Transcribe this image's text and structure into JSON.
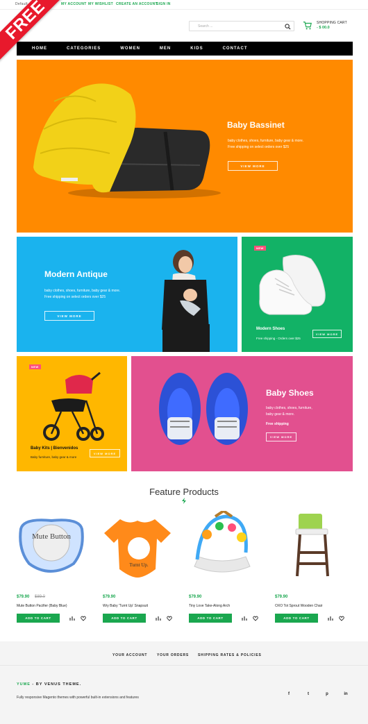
{
  "topbar": {
    "default_label": "Default",
    "links": [
      "My Account",
      "My Wishlist",
      "Create an Account",
      "Sign In"
    ]
  },
  "ribbon": "FREE",
  "search": {
    "placeholder": "Search ..."
  },
  "cart": {
    "label": "Shopping Cart",
    "amount": "- $ 00.0"
  },
  "nav": [
    "Home",
    "Categories",
    "Women",
    "Men",
    "Kids",
    "Contact"
  ],
  "banners": {
    "bassinet": {
      "title": "Baby Bassinet",
      "line1": "baby clothes, shoes, furniture, baby gear & more.",
      "line2": "Free shipping on select orders over $25",
      "button": "View More",
      "bg": "#ff8a00"
    },
    "antique": {
      "title": "Modern Antique",
      "line1": "baby clothes, shoes, furniture, baby gear & more.",
      "line2": "Free shipping on select orders over $25",
      "button": "View More",
      "bg": "#1ab3ee"
    },
    "shoes_modern": {
      "badge": "NEW",
      "title": "Modern Shoes",
      "subtitle": "Free shipping - Orders over $25",
      "button": "View More",
      "bg": "#12b266"
    },
    "kits": {
      "badge": "NEW",
      "title": "Baby Kits | Bienvenidos",
      "subtitle": "Baby furniture, baby gear & more",
      "button": "View More",
      "bg": "#ffb700"
    },
    "baby_shoes": {
      "title": "Baby Shoes",
      "line1": "baby clothes, shoes, furniture,",
      "line2": "baby gear & more.",
      "free": "Free shipping",
      "button": "View More",
      "bg": "#e2508f"
    }
  },
  "feature": {
    "title": "Feature Products"
  },
  "products": [
    {
      "price": "$79.90",
      "old_price": "$89.0",
      "name": "Mute Button Pacifier (Baby Blue)",
      "image_text": "Mute Button",
      "button": "Add to Cart"
    },
    {
      "price": "$79.90",
      "old_price": "",
      "name": "Wry Baby 'Turnt Up' Snapsuit",
      "image_text": "Turnt Up.",
      "button": "Add to Cart"
    },
    {
      "price": "$79.90",
      "old_price": "",
      "name": "Tiny Love Take-Along Arch",
      "image_text": "",
      "button": "Add to Cart"
    },
    {
      "price": "$79.90",
      "old_price": "",
      "name": "OXO Tot Sprout Wooden Chair",
      "image_text": "",
      "button": "Add to Cart"
    }
  ],
  "footer": {
    "links": [
      "Your Account",
      "Your Orders",
      "Shipping Rates & Policies"
    ],
    "brand_accent": "YUME",
    "brand_rest": " - BY VENUS THEME.",
    "desc": "Fully responsive Magento themes with powerful built-in extensions and features",
    "social": [
      "f",
      "t",
      "p",
      "in"
    ]
  },
  "colors": {
    "accent": "#1aa74f",
    "ribbon": "#e8192c"
  }
}
